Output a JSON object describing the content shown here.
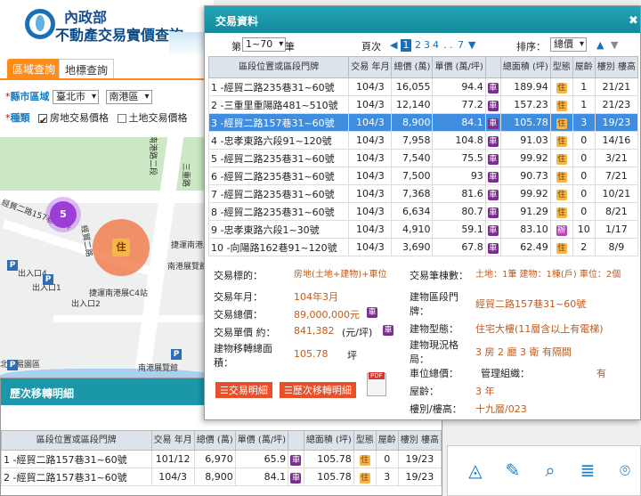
{
  "header": {
    "org": "內政部",
    "site": "不動產交易實價查詢"
  },
  "left_tabs": [
    "區域查詢",
    "地標查詢"
  ],
  "filters": {
    "region_label": "縣市區域",
    "city": "臺北市",
    "district": "南港區",
    "type_label": "種類",
    "type_options": [
      "房地交易價格",
      "土地交易價格"
    ]
  },
  "map_labels": [
    "南港路二段",
    "三重路",
    "經貿二路",
    "經貿二路157巷36弄",
    "出入口4",
    "出入口1",
    "出入口2",
    "捷運南港展覽",
    "南港展覽館",
    "捷運南港展C4站",
    "南港展覽館",
    "北貿易園區"
  ],
  "map_clusters": {
    "s": "5",
    "zhu": "住"
  },
  "history": {
    "title": "歷次移轉明細",
    "headers": [
      "區段位置或區段門牌",
      "交易\n年月",
      "總價\n(萬)",
      "單價\n(萬/坪)",
      "",
      "總面積\n(坪)",
      "型態",
      "屋齡",
      "樓別\n樓高"
    ],
    "rows": [
      {
        "addr": "1 -經貿二路157巷31~60號",
        "ym": "101/12",
        "total": "6,970",
        "unit": "65.9",
        "area": "105.78",
        "type": "住",
        "age": "0",
        "floor": "19/23"
      },
      {
        "addr": "2 -經貿二路157巷31~60號",
        "ym": "104/3",
        "total": "8,900",
        "unit": "84.1",
        "area": "105.78",
        "type": "住",
        "age": "3",
        "floor": "19/23"
      }
    ]
  },
  "modal": {
    "title": "交易資料",
    "close": "✖",
    "pager": {
      "prefix": "第",
      "range": "1~70",
      "suffix": "筆",
      "page_label": "頁次",
      "pages": [
        "1",
        "2",
        "3",
        "4",
        ". .",
        "7"
      ],
      "sort_label": "排序：",
      "sort_value": "總價"
    },
    "headers": [
      "區段位置或區段門牌",
      "交易\n年月",
      "總價\n(萬)",
      "單價\n(萬/坪)",
      "",
      "總面積\n(坪)",
      "型態",
      "屋齡",
      "樓別\n樓高"
    ],
    "rows": [
      {
        "addr": "1 -經貿二路235巷31~60號",
        "ym": "104/3",
        "total": "16,055",
        "unit": "94.4",
        "area": "189.94",
        "type": "住",
        "age": "1",
        "floor": "21/21"
      },
      {
        "addr": "2 -三重里重陽路481~510號",
        "ym": "104/3",
        "total": "12,140",
        "unit": "77.2",
        "area": "157.23",
        "type": "住",
        "age": "1",
        "floor": "21/23"
      },
      {
        "addr": "3 -經貿二路157巷31~60號",
        "ym": "104/3",
        "total": "8,900",
        "unit": "84.1",
        "area": "105.78",
        "type": "住",
        "age": "3",
        "floor": "19/23"
      },
      {
        "addr": "4 -忠孝東路六段91~120號",
        "ym": "104/3",
        "total": "7,958",
        "unit": "104.8",
        "area": "91.03",
        "type": "住",
        "age": "0",
        "floor": "14/16"
      },
      {
        "addr": "5 -經貿二路235巷31~60號",
        "ym": "104/3",
        "total": "7,540",
        "unit": "75.5",
        "area": "99.92",
        "type": "住",
        "age": "0",
        "floor": "3/21"
      },
      {
        "addr": "6 -經貿二路235巷31~60號",
        "ym": "104/3",
        "total": "7,500",
        "unit": "93",
        "area": "90.73",
        "type": "住",
        "age": "0",
        "floor": "7/21"
      },
      {
        "addr": "7 -經貿二路235巷31~60號",
        "ym": "104/3",
        "total": "7,368",
        "unit": "81.6",
        "area": "99.92",
        "type": "住",
        "age": "0",
        "floor": "10/21"
      },
      {
        "addr": "8 -經貿二路235巷31~60號",
        "ym": "104/3",
        "total": "6,634",
        "unit": "80.7",
        "area": "91.29",
        "type": "住",
        "age": "0",
        "floor": "8/21"
      },
      {
        "addr": "9 -忠孝東路六段1~30號",
        "ym": "104/3",
        "total": "4,910",
        "unit": "59.1",
        "area": "83.10",
        "type": "辦",
        "age": "10",
        "floor": "1/17"
      },
      {
        "addr": "10 -向陽路162巷91~120號",
        "ym": "104/3",
        "total": "3,690",
        "unit": "67.8",
        "area": "62.49",
        "type": "住",
        "age": "2",
        "floor": "8/9"
      }
    ],
    "detail": {
      "left": [
        {
          "k": "交易標的：",
          "v": "房地(土地+建物)+車位"
        },
        {
          "k": "交易年月：",
          "v": "104年3月"
        },
        {
          "k": "交易總價：",
          "v": "89,000,000元"
        },
        {
          "k": "交易單價 約：",
          "v": "841,382"
        },
        {
          "k": "建物移轉總面積：",
          "v": "105.78"
        }
      ],
      "unit_suffix": "(元/坪)",
      "area_suffix": "坪",
      "right": [
        {
          "k": "交易筆棟數：",
          "v": "土地：1筆 建物：1棟(戶) 車位：2個"
        },
        {
          "k": "建物區段門牌：",
          "v": "經貿二路157巷31~60號"
        },
        {
          "k": "建物型態：",
          "v": "住宅大樓(11層含以上有電梯)"
        },
        {
          "k": "建物現況格局：",
          "v": "3 房 2 廳 3 衛 有隔間"
        },
        {
          "k": "車位總價：",
          "v": "管理組織："
        },
        {
          "k": "屋齡：",
          "v": "3 年"
        },
        {
          "k": "樓別/樓高：",
          "v": "十九層/023"
        }
      ],
      "mgmt_value": "有",
      "btn_deal": "交易明細",
      "btn_transfer": "歷次移轉明細"
    }
  },
  "toolbar": [
    "measure-icon",
    "draw-icon",
    "search-icon",
    "stack-icon",
    "location-icon"
  ],
  "colors": {
    "accent": "#ff8c1a",
    "teal": "#1a97a8",
    "select_row": "#3f8de0",
    "price_text": "#c25a1c"
  }
}
